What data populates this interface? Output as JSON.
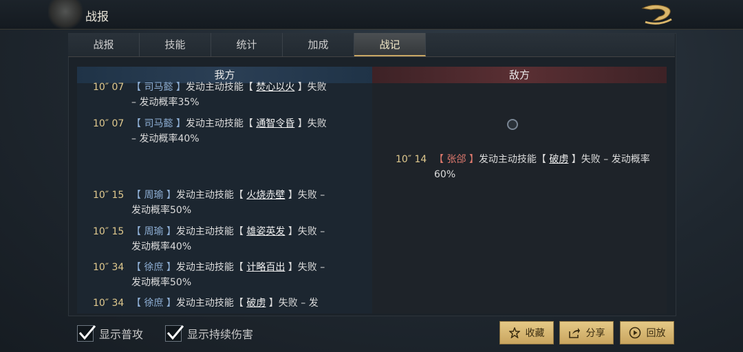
{
  "header": {
    "title": "战报"
  },
  "tabs": [
    {
      "label": "战报",
      "active": false
    },
    {
      "label": "技能",
      "active": false
    },
    {
      "label": "统计",
      "active": false
    },
    {
      "label": "加成",
      "active": false
    },
    {
      "label": "战记",
      "active": true
    }
  ],
  "columns": {
    "ours": "我方",
    "enemy": "敌方"
  },
  "log": {
    "ours": [
      {
        "time": "10″ 07",
        "name": "【 司马懿 】",
        "pre": "发动主动技能【 ",
        "skill": "焚心以火",
        "post": " 】失败 – 发动概率35%"
      },
      {
        "time": "10″ 07",
        "name": "【 司马懿 】",
        "pre": "发动主动技能【 ",
        "skill": "通智令昏",
        "post": " 】失败 – 发动概率40%"
      },
      {
        "time": "10″ 15",
        "name": "【 周瑜 】",
        "pre": "发动主动技能【 ",
        "skill": "火烧赤壁",
        "post": " 】失败 – 发动概率50%"
      },
      {
        "time": "10″ 15",
        "name": "【 周瑜 】",
        "pre": "发动主动技能【 ",
        "skill": "雄姿英发",
        "post": " 】失败 – 发动概率40%"
      },
      {
        "time": "10″ 34",
        "name": "【 徐庶 】",
        "pre": "发动主动技能【 ",
        "skill": "计略百出",
        "post": " 】失败 – 发动概率50%"
      },
      {
        "time": "10″ 34",
        "name": "【 徐庶 】",
        "pre": "发动主动技能【 ",
        "skill": "破虏",
        "post": " 】失败 – 发动概率"
      }
    ],
    "enemy": [
      {
        "time": "10″ 14",
        "name": "【 张郃 】",
        "pre": "发动主动技能【 ",
        "skill": "破虏",
        "post": " 】失败 – 发动概率60%"
      }
    ]
  },
  "options": [
    {
      "label": "显示普攻",
      "checked": true
    },
    {
      "label": "显示持续伤害",
      "checked": true
    }
  ],
  "buttons": {
    "collect": "收藏",
    "share": "分享",
    "replay": "回放"
  },
  "colors": {
    "accent": "#c9a55f",
    "our_name": "#8fb0d6",
    "enemy_name": "#e07a6e"
  }
}
